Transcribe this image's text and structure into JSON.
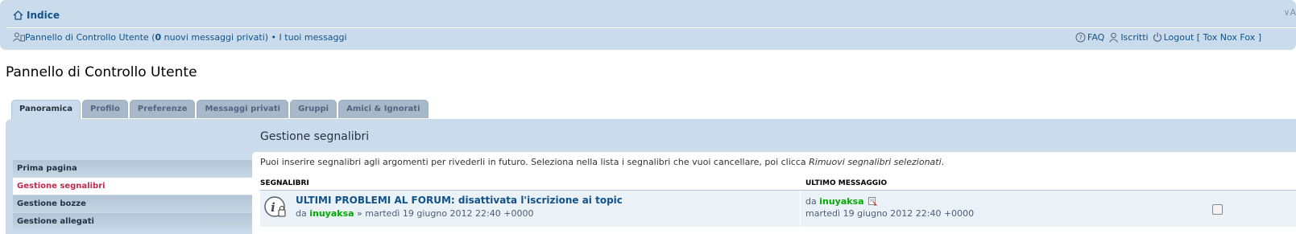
{
  "nav": {
    "index_label": "Indice",
    "ucp_link": "Pannello di Controllo Utente (",
    "new_pm_count": "0",
    "new_pm_text": " nuovi messaggi privati)",
    "separator": " • ",
    "your_posts": "I tuoi messaggi",
    "faq": "FAQ",
    "members": "Iscritti",
    "logout": "Logout [ Tox Nox Fox ]",
    "collapse": "∨A"
  },
  "page_title": "Pannello di Controllo Utente",
  "tabs": [
    {
      "label": "Panoramica",
      "active": true
    },
    {
      "label": "Profilo",
      "active": false
    },
    {
      "label": "Preferenze",
      "active": false
    },
    {
      "label": "Messaggi privati",
      "active": false
    },
    {
      "label": "Gruppi",
      "active": false
    },
    {
      "label": "Amici & Ignorati",
      "active": false
    }
  ],
  "sidebar": {
    "items": [
      {
        "label": "Prima pagina",
        "active": false
      },
      {
        "label": "Gestione segnalibri",
        "active": true
      },
      {
        "label": "Gestione bozze",
        "active": false
      },
      {
        "label": "Gestione allegati",
        "active": false
      }
    ]
  },
  "content": {
    "heading": "Gestione segnalibri",
    "intro_text": "Puoi inserire segnalibri agli argomenti per rivederli in futuro. Seleziona nella lista i segnalibri che vuoi cancellare, poi clicca ",
    "intro_action": "Rimuovi segnalibri selezionati",
    "intro_end": "."
  },
  "table": {
    "col_bookmarks": "SEGNALIBRI",
    "col_last_post": "ULTIMO MESSAGGIO",
    "rows": [
      {
        "title": "ULTIMI PROBLEMI AL FORUM: disattivata l'iscrizione ai topic",
        "by_prefix": "da ",
        "author": "inuyaksa",
        "date_text": " » martedì 19 giugno 2012 22:40 +0000",
        "last_by_prefix": "da ",
        "last_author": "inuyaksa",
        "last_date": "martedì 19 giugno 2012 22:40 +0000"
      }
    ]
  },
  "colors": {
    "navbar_bg": "#cadceb",
    "link": "#105289",
    "user_green": "#00aa00",
    "active_menu": "#bc2a4d"
  }
}
